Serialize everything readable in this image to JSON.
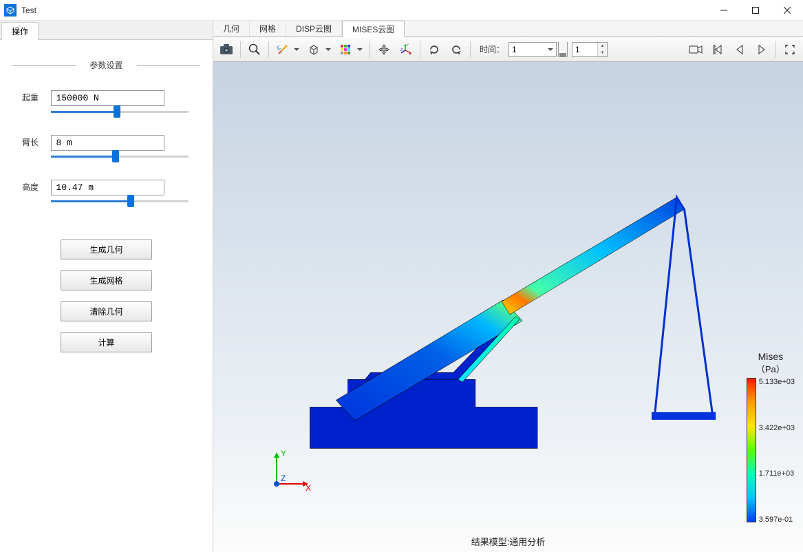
{
  "window": {
    "title": "Test"
  },
  "sidebar": {
    "tab": "操作",
    "sectionTitle": "参数设置",
    "params": {
      "lift": {
        "label": "起重",
        "value": "150000 N",
        "pct": 48
      },
      "arm": {
        "label": "臂长",
        "value": "8 m",
        "pct": 47
      },
      "ht": {
        "label": "高度",
        "value": "10.47 m",
        "pct": 58
      }
    },
    "buttons": {
      "genGeom": "生成几何",
      "genMesh": "生成网格",
      "clrGeom": "清除几何",
      "calc": "计算"
    }
  },
  "tabs": {
    "t0": "几何",
    "t1": "网格",
    "t2": "DISP云图",
    "t3": "MISES云图"
  },
  "toolbar": {
    "timeLabel": "时间：",
    "timeSelect": "1",
    "stepValue": "1"
  },
  "viewport": {
    "status": "结果模型:通用分析",
    "axes": {
      "x": "X",
      "y": "Y",
      "z": "Z"
    }
  },
  "colorbar": {
    "title": "Mises",
    "unit": "（Pa）",
    "t0": "5.133e+03",
    "t1": "3.422e+03",
    "t2": "1.711e+03",
    "t3": "3.597e-01"
  }
}
